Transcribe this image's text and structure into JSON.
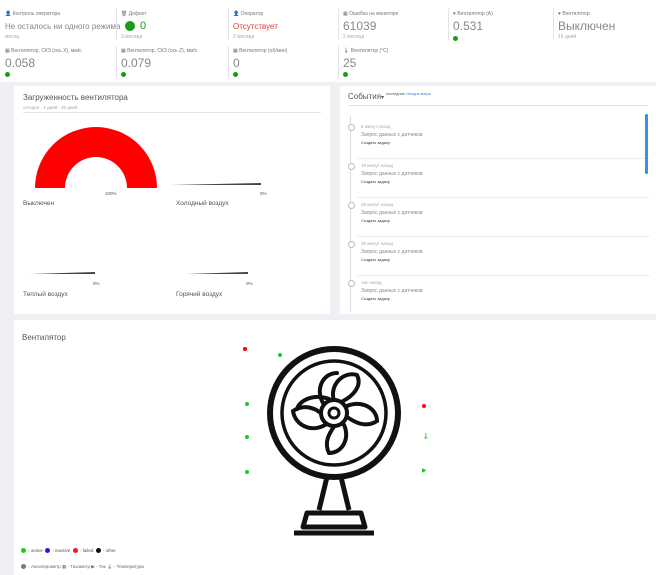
{
  "kpis": [
    {
      "label": "Контроль оператора",
      "value": "Не осталось ни одного режима",
      "sub": "месяц",
      "value_color": "#888"
    },
    {
      "label": "Дефект",
      "value": "0",
      "sub": "3 месяца",
      "value_color": "#888"
    },
    {
      "label": "Оператор",
      "value": "Отсутствует",
      "sub": "2 месяца",
      "value_color": "#e53935"
    },
    {
      "label": "Ошибка на мониторе",
      "value": "61039",
      "sub": "2 месяца",
      "value_color": "#888"
    },
    {
      "label": "Вентилятор (А)",
      "value": "0.531",
      "sub": "",
      "value_color": "#888"
    },
    {
      "label": "Вентилятор",
      "value": "Выключен",
      "sub": "16 дней",
      "value_color": "#888"
    },
    {
      "label": "Вентилятор, СКЗ (ось X), мм/с",
      "value": "0.058",
      "sub": "",
      "value_color": "#888"
    },
    {
      "label": "Вентилятор, СКЗ (ось Z), мм/с",
      "value": "0.079",
      "sub": "",
      "value_color": "#888"
    },
    {
      "label": "Вентилятор (об/мин)",
      "value": "0",
      "sub": "",
      "value_color": "#888"
    },
    {
      "label": "Вентилятор (°C)",
      "value": "25",
      "sub": "",
      "value_color": "#888"
    }
  ],
  "load_panel": {
    "title": "Загруженность вентилятора",
    "periods": [
      "сегодня",
      "2 дней",
      "30 дней"
    ],
    "gauges": [
      {
        "name": "Выключен",
        "pct_label": "100%",
        "value": 100
      },
      {
        "name": "Холодный воздух",
        "pct_label": "0%",
        "value": 0
      },
      {
        "name": "Теплый воздух",
        "pct_label": "0%",
        "value": 0
      },
      {
        "name": "Горячий воздух",
        "pct_label": "0%",
        "value": 0
      }
    ]
  },
  "events_panel": {
    "title": "События",
    "filters": [
      "последние",
      "сегодня",
      "вчера"
    ],
    "items": [
      {
        "time": "8 минут назад",
        "text": "Запрос данных с датчиков",
        "link": "Создать задачу"
      },
      {
        "time": "18 минут назад",
        "text": "Запрос данных с датчиков",
        "link": "Создать задачу"
      },
      {
        "time": "28 минут назад",
        "text": "Запрос данных с датчиков",
        "link": "Создать задачу"
      },
      {
        "time": "38 минут назад",
        "text": "Запрос данных с датчиков",
        "link": "Создать задачу"
      },
      {
        "time": "час назад",
        "text": "Запрос данных с датчиков",
        "link": "Создать задачу"
      }
    ]
  },
  "fan_panel": {
    "title": "Вентилятор",
    "legend_status": [
      {
        "label": "active",
        "color": "#22c922"
      },
      {
        "label": "inactive",
        "color": "#1a22d6"
      },
      {
        "label": "failed",
        "color": "#e51c1c"
      },
      {
        "label": "other",
        "color": "#111111"
      }
    ],
    "legend_sensors": "Акселерометр ▦ - Тахометр ▶ - Ток 🌡 - Температура"
  },
  "colors": {
    "green": "#1a9c1a",
    "red": "#ff0000",
    "sensor_green": "#22c922"
  }
}
